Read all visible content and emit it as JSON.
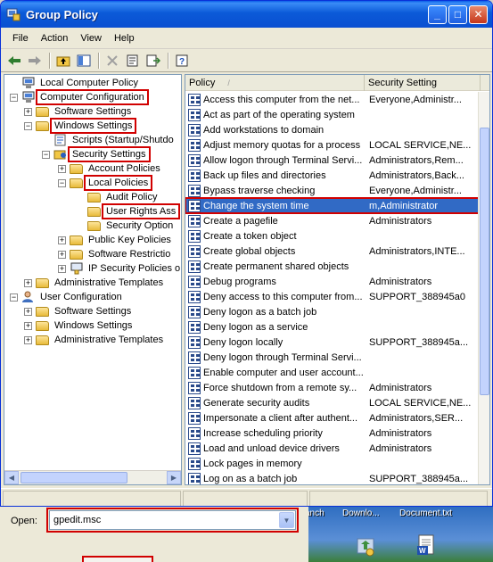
{
  "window": {
    "title": "Group Policy",
    "controls": {
      "minimize": "_",
      "maximize": "□",
      "close": "✕"
    }
  },
  "menu": [
    "File",
    "Action",
    "View",
    "Help"
  ],
  "toolbar": {
    "icons": [
      "back-arrow-icon",
      "forward-arrow-icon",
      "up-folder-icon",
      "show-hide-tree-icon",
      "delete-icon",
      "properties-icon",
      "export-list-icon",
      "help-icon"
    ]
  },
  "tree": {
    "items": [
      {
        "label": "Local Computer Policy",
        "level": 0,
        "expander": "",
        "icon": "computer-policy-icon"
      },
      {
        "label": "Computer Configuration",
        "level": 0,
        "expander": "−",
        "icon": "computer-icon",
        "highlight": true
      },
      {
        "label": "Software Settings",
        "level": 1,
        "expander": "+",
        "icon": "folder-icon"
      },
      {
        "label": "Windows Settings",
        "level": 1,
        "expander": "−",
        "icon": "folder-icon",
        "highlight": true
      },
      {
        "label": "Scripts (Startup/Shutdo",
        "level": 2,
        "expander": "",
        "icon": "scripts-icon"
      },
      {
        "label": "Security Settings",
        "level": 2,
        "expander": "−",
        "icon": "security-icon",
        "highlight": true
      },
      {
        "label": "Account Policies",
        "level": 3,
        "expander": "+",
        "icon": "folder-icon"
      },
      {
        "label": "Local Policies",
        "level": 3,
        "expander": "−",
        "icon": "folder-icon",
        "highlight": true
      },
      {
        "label": "Audit Policy",
        "level": 4,
        "expander": "",
        "icon": "folder-icon"
      },
      {
        "label": "User Rights Ass",
        "level": 4,
        "expander": "",
        "icon": "folder-icon",
        "highlight": true
      },
      {
        "label": "Security Option",
        "level": 4,
        "expander": "",
        "icon": "folder-icon"
      },
      {
        "label": "Public Key Policies",
        "level": 3,
        "expander": "+",
        "icon": "folder-icon"
      },
      {
        "label": "Software Restrictio",
        "level": 3,
        "expander": "+",
        "icon": "folder-icon"
      },
      {
        "label": "IP Security Policies o",
        "level": 3,
        "expander": "+",
        "icon": "ip-security-icon"
      },
      {
        "label": "Administrative Templates",
        "level": 1,
        "expander": "+",
        "icon": "folder-icon"
      },
      {
        "label": "User Configuration",
        "level": 0,
        "expander": "−",
        "icon": "user-icon"
      },
      {
        "label": "Software Settings",
        "level": 1,
        "expander": "+",
        "icon": "folder-icon"
      },
      {
        "label": "Windows Settings",
        "level": 1,
        "expander": "+",
        "icon": "folder-icon"
      },
      {
        "label": "Administrative Templates",
        "level": 1,
        "expander": "+",
        "icon": "folder-icon"
      }
    ]
  },
  "list": {
    "columns": [
      "Policy",
      "Security Setting"
    ],
    "sort_indicator": "/",
    "rows": [
      {
        "policy": "Access this computer from the net...",
        "setting": "Everyone,Administr..."
      },
      {
        "policy": "Act as part of the operating system",
        "setting": ""
      },
      {
        "policy": "Add workstations to domain",
        "setting": ""
      },
      {
        "policy": "Adjust memory quotas for a process",
        "setting": "LOCAL SERVICE,NE..."
      },
      {
        "policy": "Allow logon through Terminal Servi...",
        "setting": "Administrators,Rem..."
      },
      {
        "policy": "Back up files and directories",
        "setting": "Administrators,Back..."
      },
      {
        "policy": "Bypass traverse checking",
        "setting": "Everyone,Administr..."
      },
      {
        "policy": "Change the system time",
        "setting": "m,Administrator",
        "selected": true
      },
      {
        "policy": "Create a pagefile",
        "setting": "Administrators"
      },
      {
        "policy": "Create a token object",
        "setting": ""
      },
      {
        "policy": "Create global objects",
        "setting": "Administrators,INTE..."
      },
      {
        "policy": "Create permanent shared objects",
        "setting": ""
      },
      {
        "policy": "Debug programs",
        "setting": "Administrators"
      },
      {
        "policy": "Deny access to this computer from...",
        "setting": "SUPPORT_388945a0"
      },
      {
        "policy": "Deny logon as a batch job",
        "setting": ""
      },
      {
        "policy": "Deny logon as a service",
        "setting": ""
      },
      {
        "policy": "Deny logon locally",
        "setting": "SUPPORT_388945a..."
      },
      {
        "policy": "Deny logon through Terminal Servi...",
        "setting": ""
      },
      {
        "policy": "Enable computer and user account...",
        "setting": ""
      },
      {
        "policy": "Force shutdown from a remote sy...",
        "setting": "Administrators"
      },
      {
        "policy": "Generate security audits",
        "setting": "LOCAL SERVICE,NE..."
      },
      {
        "policy": "Impersonate a client after authent...",
        "setting": "Administrators,SER..."
      },
      {
        "policy": "Increase scheduling priority",
        "setting": "Administrators"
      },
      {
        "policy": "Load and unload device drivers",
        "setting": "Administrators"
      },
      {
        "policy": "Lock pages in memory",
        "setting": ""
      },
      {
        "policy": "Log on as a batch job",
        "setting": "SUPPORT_388945a..."
      }
    ]
  },
  "run_dialog": {
    "open_label": "Open:",
    "open_value": "gpedit.msc"
  },
  "desktop": {
    "labels": [
      "anch",
      "Downlo...",
      "Document.txt"
    ],
    "icons": [
      "recycle-folder-icon",
      "word-document-icon"
    ]
  },
  "colors": {
    "titlebar": "#0a5ee8",
    "selection": "#316ac5",
    "highlight_box": "#d10000"
  }
}
